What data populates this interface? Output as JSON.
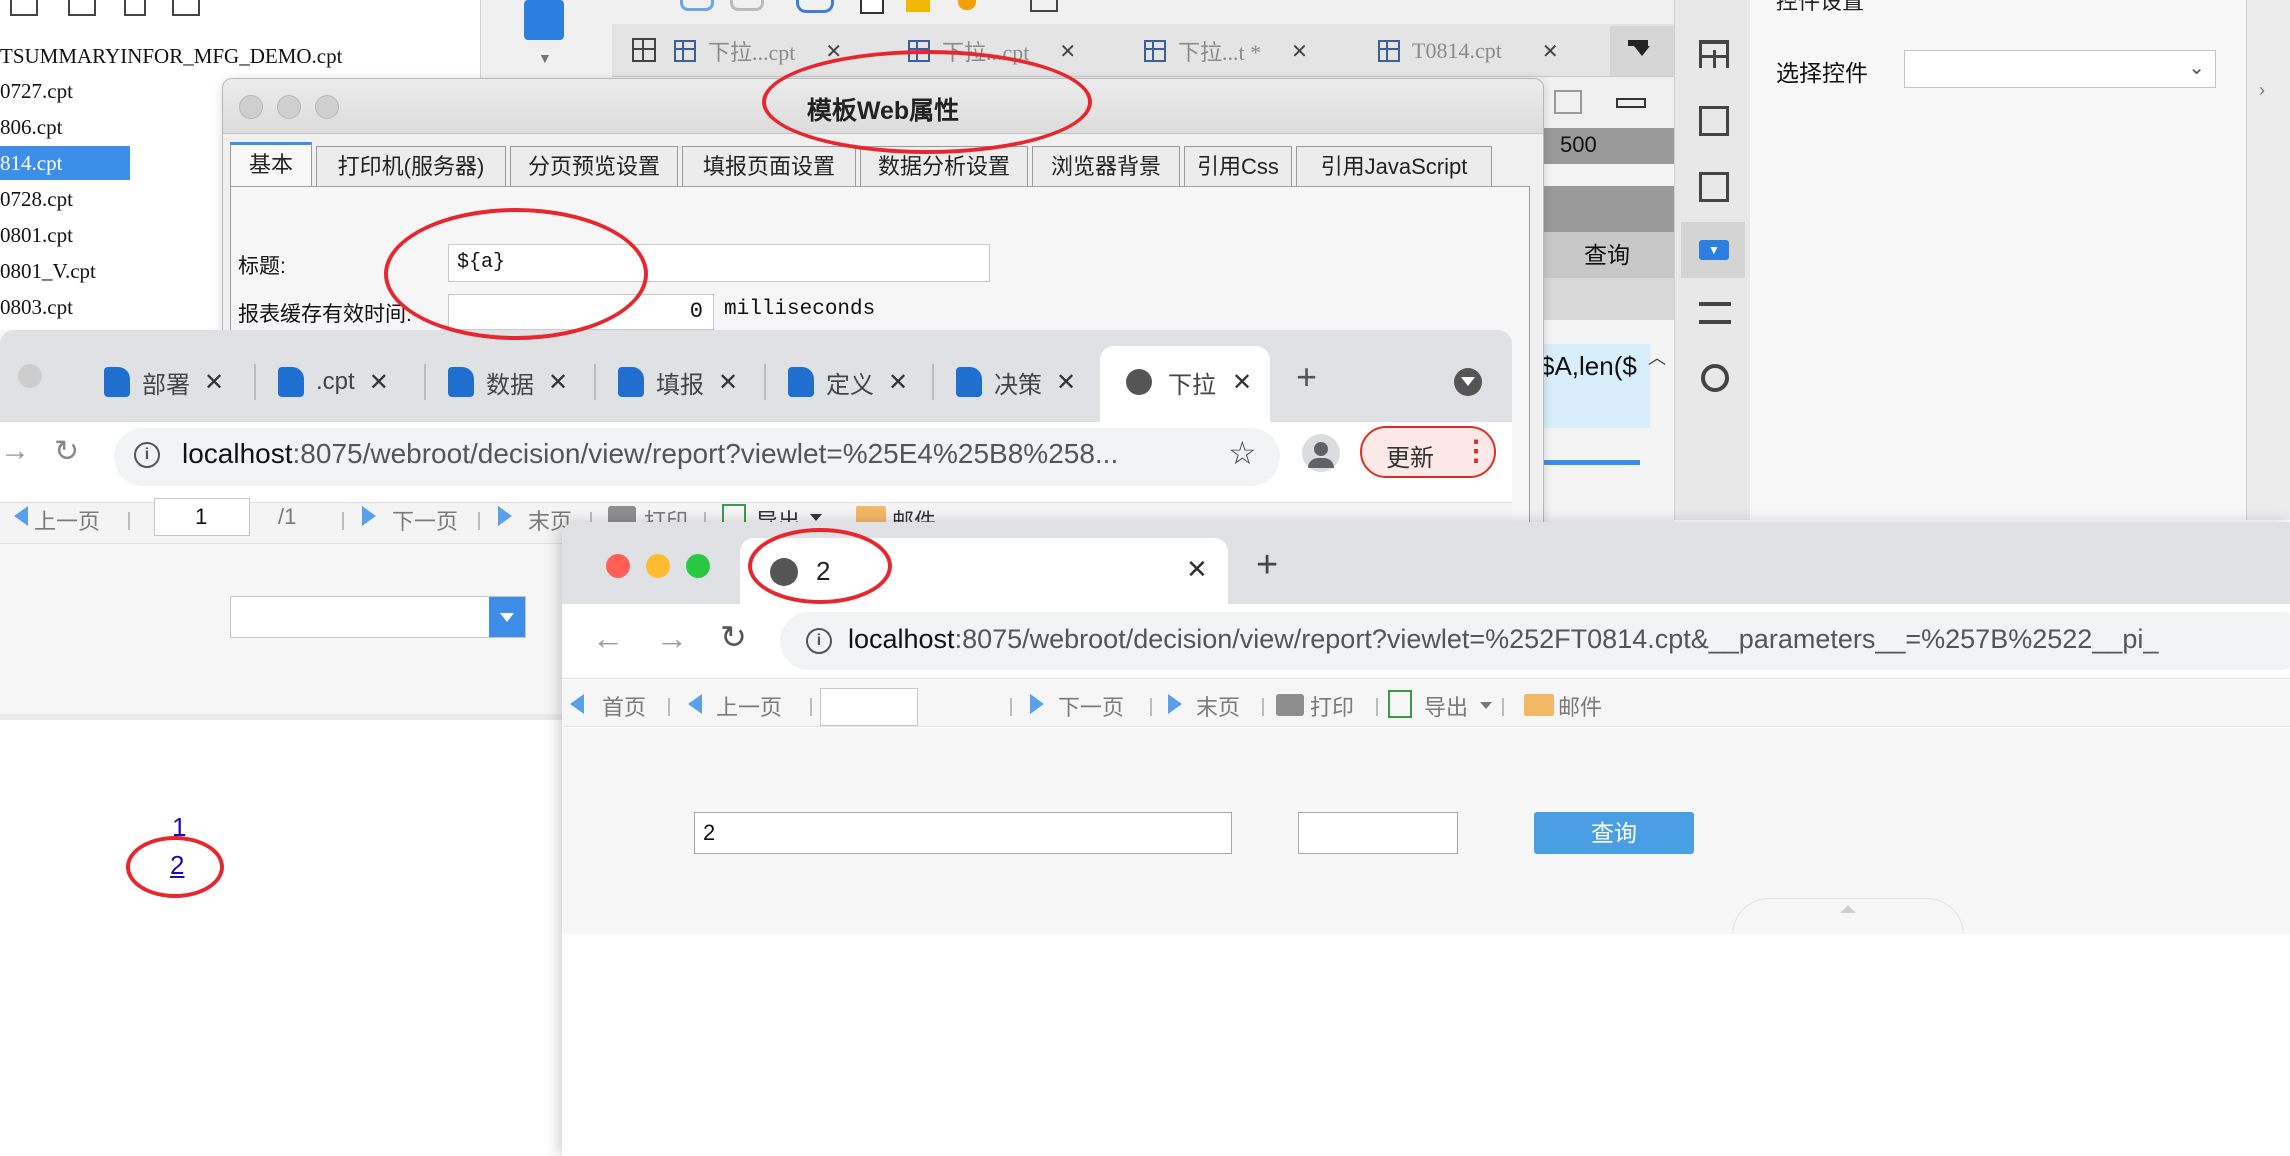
{
  "designer": {
    "files": [
      {
        "name": "TSUMMARYINFOR_MFG_DEMO.cpt",
        "selected": false
      },
      {
        "name": "0727.cpt",
        "selected": false
      },
      {
        "name": "806.cpt",
        "selected": false
      },
      {
        "name": "814.cpt",
        "selected": true
      },
      {
        "name": "0728.cpt",
        "selected": false
      },
      {
        "name": "0801.cpt",
        "selected": false
      },
      {
        "name": "0801_V.cpt",
        "selected": false
      },
      {
        "name": "0803.cpt",
        "selected": false
      }
    ],
    "tabs": [
      {
        "label": "下拉...cpt",
        "close": "✕"
      },
      {
        "label": "下拉...cpt",
        "close": "✕"
      },
      {
        "label": "下拉...t *",
        "close": "✕"
      },
      {
        "label": "T0814.cpt",
        "close": "✕"
      }
    ],
    "ruler_mark": "500",
    "query_cell": "查询",
    "formula_cell": "$A,len($",
    "right_panel": {
      "header": "控件设置",
      "select_label": "选择控件",
      "select_value": ""
    }
  },
  "web_dialog": {
    "title": "模板Web属性",
    "tabs": [
      "基本",
      "打印机(服务器)",
      "分页预览设置",
      "填报页面设置",
      "数据分析设置",
      "浏览器背景",
      "引用Css",
      "引用JavaScript"
    ],
    "active_tab": "基本",
    "title_label": "标题:",
    "title_value": "${a}",
    "cache_label": "报表缓存有效时间:",
    "cache_value": "0",
    "cache_unit": "milliseconds"
  },
  "browser_back": {
    "tabs": [
      "部署",
      ".cpt",
      "数据",
      "填报",
      "定义",
      "决策",
      "下拉"
    ],
    "new_tab": "+",
    "url_host": "localhost",
    "url_rest": ":8075/webroot/decision/view/report?viewlet=%25E4%25B8%258...",
    "update_button": "更新",
    "toolbar": {
      "prev": "上一页",
      "page_input": "1",
      "page_total": "/1",
      "next": "下一页",
      "last": "末页",
      "print": "打印",
      "export": "导出",
      "mail": "邮件"
    },
    "links": [
      "1",
      "2"
    ]
  },
  "browser_front": {
    "tab_title": "2",
    "tab_close": "✕",
    "new_tab": "+",
    "url_host": "localhost",
    "url_rest": ":8075/webroot/decision/view/report?viewlet=%252FT0814.cpt&__parameters__=%257B%2522__pi_",
    "toolbar": {
      "first": "首页",
      "prev": "上一页",
      "page_input": "",
      "next": "下一页",
      "last": "末页",
      "print": "打印",
      "export": "导出",
      "mail": "邮件"
    },
    "param_value": "2",
    "param_value2": "",
    "query_button": "查询"
  },
  "colors": {
    "accent": "#3d8ee8",
    "annotation": "#e8262e",
    "query_button": "#4a9ee4",
    "link": "#1a0dab"
  }
}
